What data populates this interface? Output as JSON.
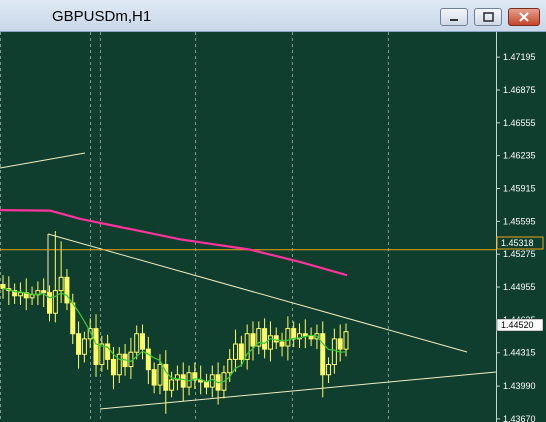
{
  "window": {
    "title": "GBPUSDm,H1",
    "buttons": [
      "minimize",
      "restore",
      "close"
    ]
  },
  "chart_data": {
    "type": "candlestick",
    "symbol": "GBPUSDm",
    "timeframe": "H1",
    "y_ticks": [
      "1.47195",
      "1.46875",
      "1.46555",
      "1.46235",
      "1.45915",
      "1.45595",
      "1.45275",
      "1.44955",
      "1.44635",
      "1.44315",
      "1.43990",
      "1.43670"
    ],
    "ylim": [
      1.4364,
      1.4744
    ],
    "horizontal_line": {
      "price": "1.45318",
      "color": "#e8a317"
    },
    "current_price": "1.44520",
    "colors": {
      "candles": "#ffff66",
      "ma_fast": "#33cc33",
      "ma_slow": "#ff3399",
      "trendlines": "#f0f0c0",
      "grid": "#9bb8a8",
      "background": "#0f3d2e"
    },
    "closes": [
      1.4494,
      1.4492,
      1.4487,
      1.449,
      1.4485,
      1.4488,
      1.4492,
      1.449,
      1.447,
      1.4492,
      1.4505,
      1.448,
      1.445,
      1.443,
      1.4445,
      1.4455,
      1.442,
      1.444,
      1.4425,
      1.441,
      1.443,
      1.4418,
      1.4432,
      1.445,
      1.4435,
      1.4415,
      1.44,
      1.442,
      1.4395,
      1.4405,
      1.441,
      1.4398,
      1.4412,
      1.4405,
      1.4403,
      1.4398,
      1.441,
      1.4395,
      1.4412,
      1.4425,
      1.444,
      1.4425,
      1.445,
      1.4438,
      1.4455,
      1.4435,
      1.4448,
      1.4442,
      1.4438,
      1.4455,
      1.4445,
      1.445,
      1.4448,
      1.4445,
      1.445,
      1.441,
      1.442,
      1.4445,
      1.4435,
      1.4452
    ]
  }
}
